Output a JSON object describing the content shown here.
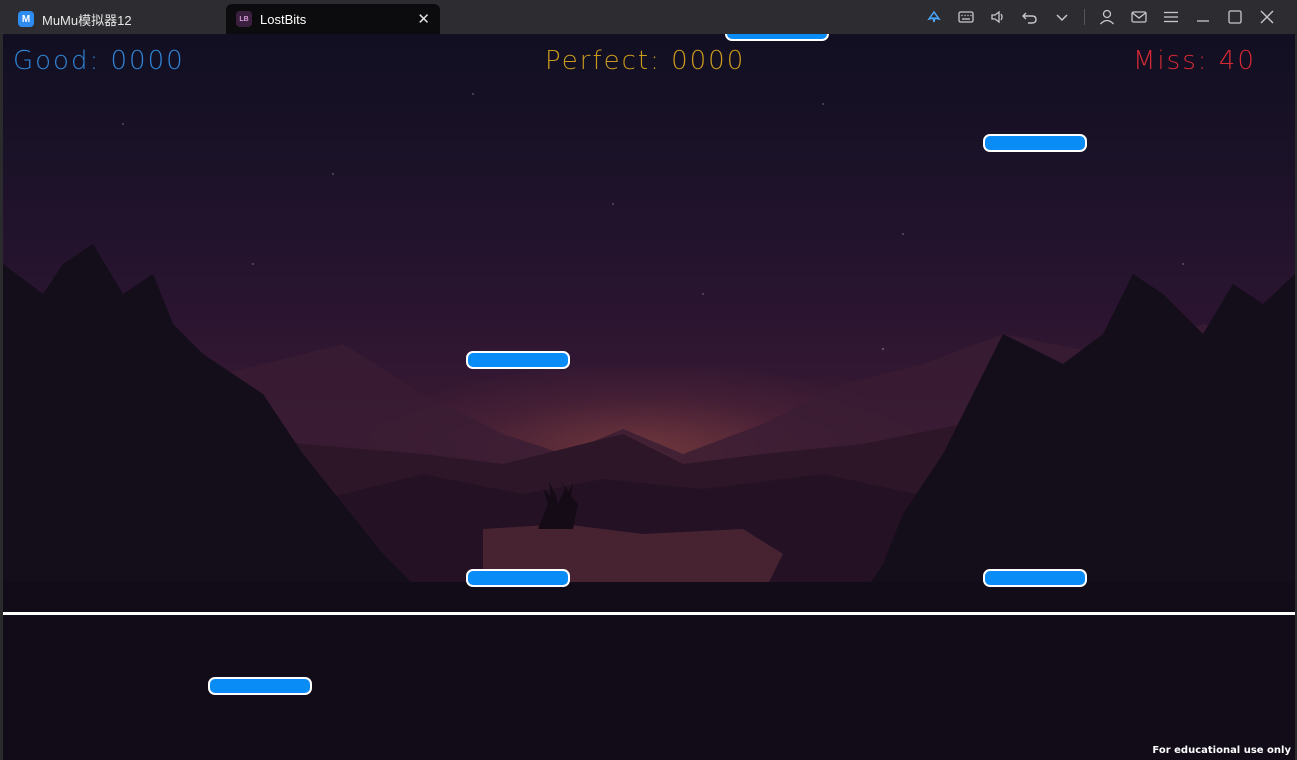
{
  "window": {
    "app_tab_label": "MuMu模拟器12",
    "game_tab_label": "LostBits",
    "close_glyph": "✕"
  },
  "toolbar_icons": [
    "gamepad-icon",
    "keyboard-icon",
    "volume-icon",
    "back-icon",
    "chevron-down-icon",
    "user-icon",
    "mail-icon",
    "menu-icon",
    "minimize-icon",
    "maximize-icon",
    "close-icon"
  ],
  "hud": {
    "good": "Good: 0000",
    "perfect": "Perfect: 0000",
    "miss": "Miss: 40"
  },
  "colors": {
    "good": "#2f86d8",
    "perfect": "#c99a1e",
    "miss": "#d42a35",
    "note": "#0a8cf7"
  },
  "watermark": "For educational use only"
}
